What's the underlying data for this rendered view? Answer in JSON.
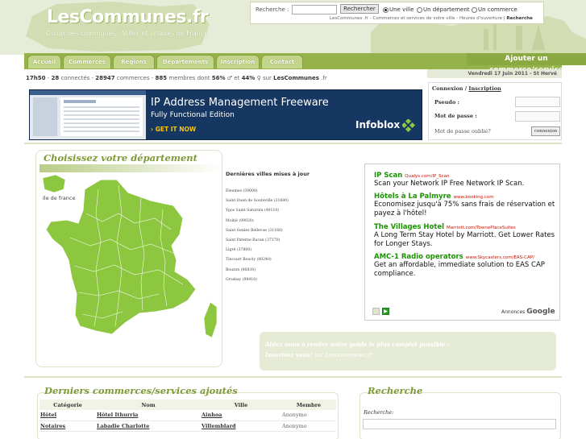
{
  "header": {
    "logo": "LesCommunes.fr",
    "tagline": "Guide des communes : Villes et villages de France"
  },
  "search": {
    "label": "Recherche :",
    "input_value": "",
    "button": "Rechercher",
    "options": [
      "Une ville",
      "Un département",
      "Un commerce"
    ],
    "selected_option": "Une ville",
    "caption_text": "LesCommunes .fr - Commerces et services de votre ville - Heures d'ouverture",
    "caption_link": "Recherche"
  },
  "nav": {
    "tabs": [
      "Accueil",
      "Commerces",
      "Regions",
      "Départements",
      "Inscription",
      "Contact"
    ],
    "add_commerce": "Ajouter un commerce/service",
    "date": "Vendredi 17 Juin 2011 - St Hervé"
  },
  "stats": {
    "time": "17h50",
    "connected": "28",
    "connected_label": "connectés",
    "commerces": "28947",
    "commerces_label": "commerces",
    "members": "885",
    "members_label": "membres dont",
    "male_pct": "56%",
    "female_pct": "44%",
    "on": "sur",
    "site": "LesCommunes",
    "tld": ".fr"
  },
  "banner": {
    "title": "IP Address Management Freeware",
    "subtitle": "Fully Functional Edition",
    "cta": "› GET IT NOW",
    "brand": "Infoblox"
  },
  "login": {
    "connexion": "Connexion",
    "sep": " / ",
    "inscription": "Inscription",
    "pseudo_label": "Pseudo :",
    "password_label": "Mot de passe :",
    "forgot": "Mot de passe oublié?",
    "button": "connexion"
  },
  "map": {
    "title": "Choisissez votre département",
    "hover_label": "ile de france"
  },
  "cities": {
    "title": "Dernières villes mises à jour",
    "items": [
      "Éleumes (59000)",
      "Saint Ouen de Gouteville (31680)",
      "Ygos Saint Saturnin (40110)",
      "Moitié (09020)",
      "Saint Genies Bellevue (31180)",
      "Saint Paterne Racan (37370)",
      "Ligré (37800)",
      "Tincourt Boucly (80240)",
      "Bouzon (06830)",
      "Grosbay (98410)"
    ]
  },
  "ads": {
    "items": [
      {
        "title": "IP Scan",
        "url": "Qualys.com/IP_Scan",
        "body": "Scan your Network IP Free Network IP Scan."
      },
      {
        "title": "Hôtels à La Palmyre",
        "url": "www.booking.com",
        "body": "Economisez jusqu'à 75% sans frais de réservation et payez à l'hôtel!"
      },
      {
        "title": "The Villages Hotel",
        "url": "Marriott.com/TownePlaceSuites",
        "body": "A Long Term Stay Hotel by Marriott. Get Lower Rates for Longer Stays."
      },
      {
        "title": "AMC-1 Radio operators",
        "url": "www.Skycasters.com/EAS-CAP/",
        "body": "Get an affordable, immediate solution to EAS CAP compliance."
      }
    ],
    "footer_label": "Annonces",
    "footer_brand": "Google"
  },
  "help": {
    "line1": "Aidez nous à rendre notre guide le plus complet possible :",
    "line2_link": "Inscrivez vous!",
    "line2_rest": " sur Lescommunes.fr"
  },
  "recent": {
    "title": "Derniers commerces/services ajoutés",
    "columns": [
      "Catégorie",
      "Nom",
      "Ville",
      "Membre"
    ],
    "rows": [
      [
        "Hôtel",
        "Hôtel Ithurria",
        "Ainhoa",
        "Anonyme"
      ],
      [
        "Notaires",
        "Labadie Charlotte",
        "Villemblard",
        "Anonyme"
      ],
      [
        "",
        "",
        "",
        ""
      ]
    ]
  },
  "search2": {
    "title": "Recherche",
    "label": "Recherche:"
  },
  "colors": {
    "brand_green": "#95b34a",
    "title_green": "#7d9a36",
    "ad_title": "#199400"
  }
}
